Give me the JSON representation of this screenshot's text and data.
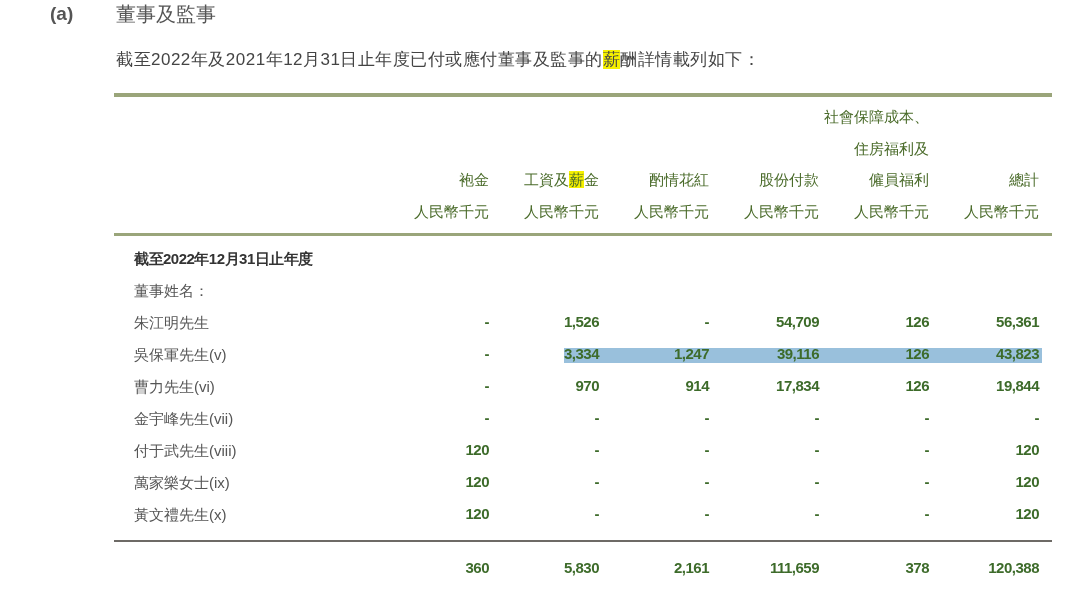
{
  "section": {
    "label": "(a)",
    "title": "董事及監事"
  },
  "intro": [
    {
      "text": "截至2022年及2021年12月31日止年度已付或應付董事及監事的",
      "highlighted": false
    },
    {
      "text": "薪",
      "highlighted": true
    },
    {
      "text": "酬詳情載列如下：",
      "highlighted": false
    }
  ],
  "table": {
    "columns": [
      {
        "lines": [
          [
            {
              "text": "袍金",
              "highlighted": false
            }
          ]
        ],
        "unit": "人民幣千元"
      },
      {
        "lines": [
          [
            {
              "text": "工資及",
              "highlighted": false
            },
            {
              "text": "薪",
              "highlighted": true
            },
            {
              "text": "金",
              "highlighted": false
            }
          ]
        ],
        "unit": "人民幣千元"
      },
      {
        "lines": [
          [
            {
              "text": "酌情花紅",
              "highlighted": false
            }
          ]
        ],
        "unit": "人民幣千元"
      },
      {
        "lines": [
          [
            {
              "text": "股份付款",
              "highlighted": false
            }
          ]
        ],
        "unit": "人民幣千元"
      },
      {
        "lines": [
          [
            {
              "text": "社會保障成本、",
              "highlighted": false
            }
          ],
          [
            {
              "text": "住房福利及",
              "highlighted": false
            }
          ],
          [
            {
              "text": "僱員福利",
              "highlighted": false
            }
          ]
        ],
        "unit": "人民幣千元"
      },
      {
        "lines": [
          [
            {
              "text": "總計",
              "highlighted": false
            }
          ]
        ],
        "unit": "人民幣千元"
      }
    ],
    "period": "截至2022年12月31日止年度",
    "group_label": "董事姓名：",
    "rows": [
      {
        "name": "朱江明先生",
        "selected": false,
        "values": [
          "-",
          "1,526",
          "-",
          "54,709",
          "126",
          "56,361"
        ]
      },
      {
        "name": "吳保軍先生(v)",
        "selected": true,
        "values": [
          "-",
          "3,334",
          "1,247",
          "39,116",
          "126",
          "43,823"
        ]
      },
      {
        "name": "曹力先生(vi)",
        "selected": false,
        "values": [
          "-",
          "970",
          "914",
          "17,834",
          "126",
          "19,844"
        ]
      },
      {
        "name": "金宇峰先生(vii)",
        "selected": false,
        "values": [
          "-",
          "-",
          "-",
          "-",
          "-",
          "-"
        ]
      },
      {
        "name": "付于武先生(viii)",
        "selected": false,
        "values": [
          "120",
          "-",
          "-",
          "-",
          "-",
          "120"
        ]
      },
      {
        "name": "萬家樂女士(ix)",
        "selected": false,
        "values": [
          "120",
          "-",
          "-",
          "-",
          "-",
          "120"
        ]
      },
      {
        "name": "黃文禮先生(x)",
        "selected": false,
        "values": [
          "120",
          "-",
          "-",
          "-",
          "-",
          "120"
        ]
      }
    ],
    "totals": [
      "360",
      "5,830",
      "2,161",
      "111,659",
      "378",
      "120,388"
    ]
  }
}
